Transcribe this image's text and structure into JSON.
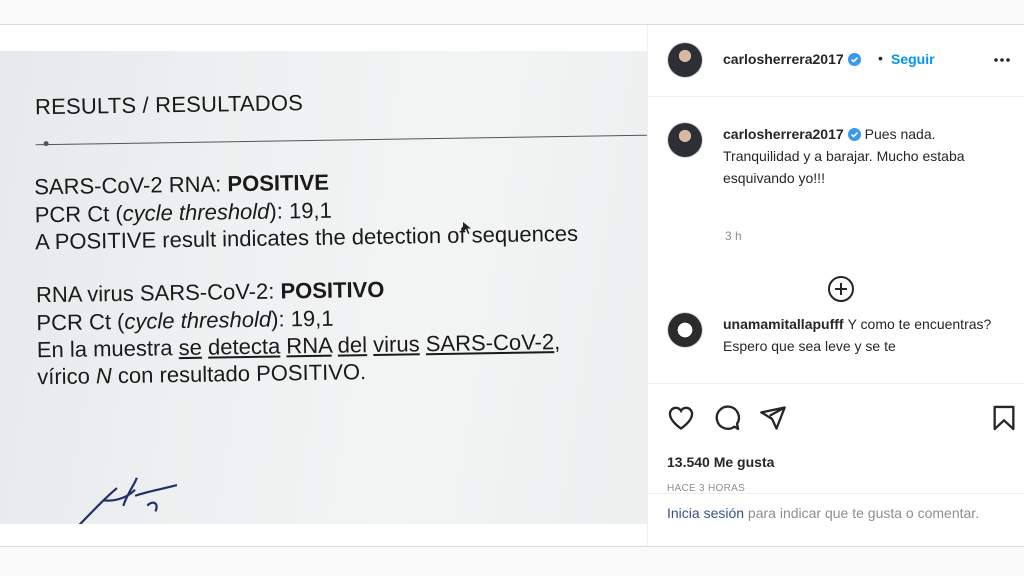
{
  "photo": {
    "doc_title": "RESULTS / RESULTADOS",
    "lines": [
      {
        "a": "SARS-CoV-2 RNA: ",
        "b": "POSITIVE"
      },
      {
        "a": "PCR Ct (",
        "i": "cycle threshold",
        "c": "): 19,1"
      },
      {
        "a": "A POSITIVE result indicates the detection of sequences"
      },
      {
        "a": "RNA virus SARS-CoV-2: ",
        "b": "POSITIVO"
      },
      {
        "a": "PCR Ct (",
        "i": "cycle threshold",
        "c": "): 19,1"
      },
      {
        "a": "En la muestra ",
        "u1": "se",
        "u2": "detecta",
        "u3": "RNA",
        "u4": "del",
        "u5": "virus",
        "u6": "SARS-CoV-2",
        "c": ","
      },
      {
        "a": "vírico ",
        "i": "N",
        "c": " con resultado POSITIVO."
      }
    ]
  },
  "header": {
    "username": "carlosherrera2017",
    "separator": "•",
    "follow_label": "Seguir",
    "more_icon": "more-horizontal-icon"
  },
  "caption": {
    "username": "carlosherrera2017",
    "text": "Pues nada. Tranquilidad y a barajar. Mucho estaba esquivando yo!!!",
    "time": "3 h"
  },
  "load_more_icon": "plus-circle-icon",
  "comment": {
    "username": "unamamitallapufff",
    "text": "Y como te encuentras? Espero que sea leve y se te"
  },
  "actions": {
    "likes": "13.540 Me gusta",
    "ago": "HACE 3 HORAS"
  },
  "login": {
    "link": "Inicia sesión",
    "text": " para indicar que te gusta o comentar."
  },
  "colors": {
    "accent": "#0095f6",
    "verified": "#3897f0",
    "text": "#262626",
    "muted": "#8e8e8e",
    "link": "#385185"
  }
}
